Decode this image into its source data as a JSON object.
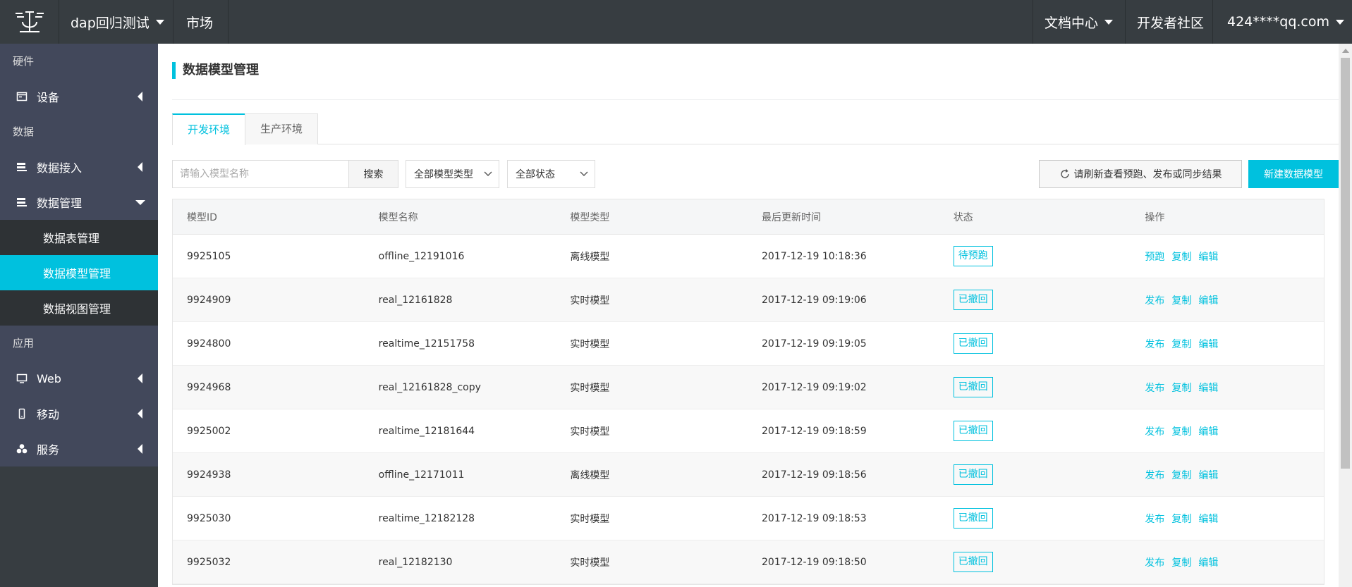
{
  "topbar": {
    "project": "dap回归测试",
    "market": "市场",
    "docs": "文档中心",
    "community": "开发者社区",
    "account": "424****qq.com"
  },
  "sidebar": {
    "sections": [
      "硬件",
      "数据",
      "应用"
    ],
    "items": {
      "device": "设备",
      "data_access": "数据接入",
      "data_manage": "数据管理",
      "table_manage": "数据表管理",
      "model_manage": "数据模型管理",
      "view_manage": "数据视图管理",
      "web": "Web",
      "mobile": "移动",
      "service": "服务"
    }
  },
  "main": {
    "title": "数据模型管理",
    "tabs": [
      "开发环境",
      "生产环境"
    ],
    "search": {
      "placeholder": "请输入模型名称",
      "button": "搜索"
    },
    "filters": {
      "type": "全部模型类型",
      "status": "全部状态"
    },
    "refresh_label": "请刷新查看预跑、发布或同步结果",
    "create_label": "新建数据模型",
    "columns": [
      "模型ID",
      "模型名称",
      "模型类型",
      "最后更新时间",
      "状态",
      "操作"
    ],
    "rows": [
      {
        "id": "9925105",
        "name": "offline_12191016",
        "type": "离线模型",
        "time": "2017-12-19 10:18:36",
        "status": "待预跑",
        "ops": [
          "预跑",
          "复制",
          "编辑"
        ]
      },
      {
        "id": "9924909",
        "name": "real_12161828",
        "type": "实时模型",
        "time": "2017-12-19 09:19:06",
        "status": "已撤回",
        "ops": [
          "发布",
          "复制",
          "编辑"
        ]
      },
      {
        "id": "9924800",
        "name": "realtime_12151758",
        "type": "实时模型",
        "time": "2017-12-19 09:19:05",
        "status": "已撤回",
        "ops": [
          "发布",
          "复制",
          "编辑"
        ]
      },
      {
        "id": "9924968",
        "name": "real_12161828_copy",
        "type": "实时模型",
        "time": "2017-12-19 09:19:02",
        "status": "已撤回",
        "ops": [
          "发布",
          "复制",
          "编辑"
        ]
      },
      {
        "id": "9925002",
        "name": "realtime_12181644",
        "type": "实时模型",
        "time": "2017-12-19 09:18:59",
        "status": "已撤回",
        "ops": [
          "发布",
          "复制",
          "编辑"
        ]
      },
      {
        "id": "9924938",
        "name": "offline_12171011",
        "type": "离线模型",
        "time": "2017-12-19 09:18:56",
        "status": "已撤回",
        "ops": [
          "发布",
          "复制",
          "编辑"
        ]
      },
      {
        "id": "9925030",
        "name": "realtime_12182128",
        "type": "实时模型",
        "time": "2017-12-19 09:18:53",
        "status": "已撤回",
        "ops": [
          "发布",
          "复制",
          "编辑"
        ]
      },
      {
        "id": "9925032",
        "name": "real_12182130",
        "type": "实时模型",
        "time": "2017-12-19 09:18:50",
        "status": "已撤回",
        "ops": [
          "发布",
          "复制",
          "编辑"
        ]
      }
    ]
  },
  "colors": {
    "accent": "#00c1de",
    "topbar": "#373d41",
    "sidebar": "#42485b"
  }
}
